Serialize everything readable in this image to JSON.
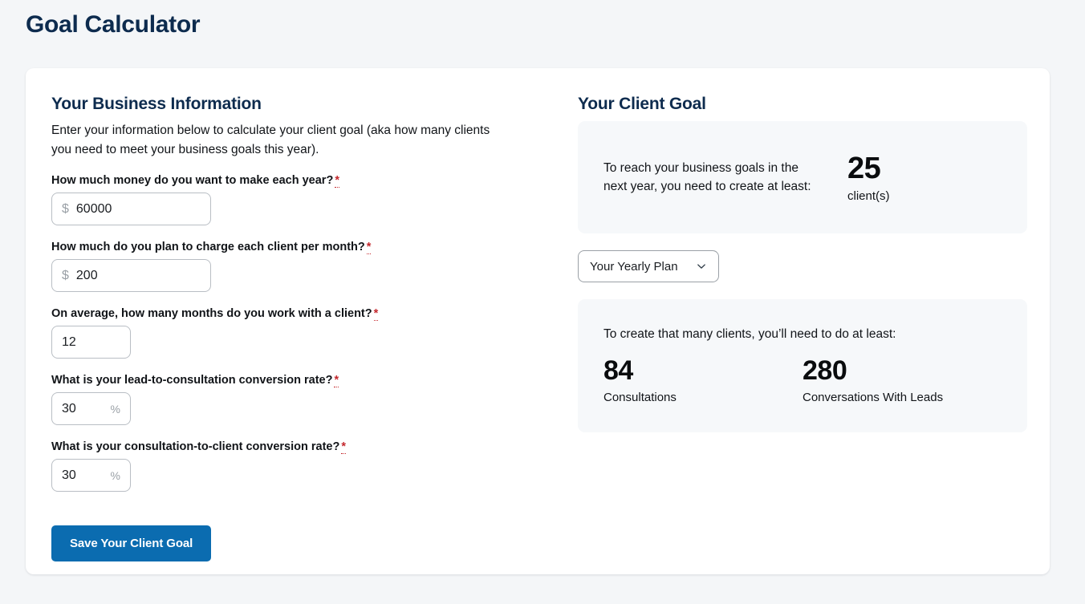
{
  "page": {
    "title": "Goal Calculator"
  },
  "business_info": {
    "heading": "Your Business Information",
    "intro": "Enter your information below to calculate your client goal (aka how many clients you need to meet your business goals this year).",
    "required_marker": "*",
    "fields": [
      {
        "label": "How much money do you want to make each year?",
        "prefix": "$",
        "suffix": "",
        "value": "60000",
        "placeholder": "",
        "name": "annual-income-goal"
      },
      {
        "label": "How much do you plan to charge each client per month?",
        "prefix": "$",
        "suffix": "",
        "value": "200",
        "placeholder": "",
        "name": "monthly-client-rate"
      },
      {
        "label": "On average, how many months do you work with a client?",
        "prefix": "",
        "suffix": "",
        "value": "12",
        "placeholder": "",
        "name": "months-per-client"
      },
      {
        "label": "What is your lead-to-consultation conversion rate?",
        "prefix": "",
        "suffix": "%",
        "value": "30",
        "placeholder": "",
        "name": "lead-to-consultation-rate"
      },
      {
        "label": "What is your consultation-to-client conversion rate?",
        "prefix": "",
        "suffix": "%",
        "value": "30",
        "placeholder": "",
        "name": "consultation-to-client-rate"
      }
    ],
    "save_label": "Save Your Client Goal"
  },
  "client_goal": {
    "heading": "Your Client Goal",
    "goal_sentence": "To reach your business goals in the next year, you need to create at least:",
    "goal_number": "25",
    "goal_unit": "client(s)",
    "plan_select": {
      "selected": "Your Yearly Plan",
      "options": [
        "Your Yearly Plan"
      ]
    },
    "actions_intro": "To create that many clients, you’ll need to do at least:",
    "metrics": [
      {
        "value": "84",
        "label": "Consultations"
      },
      {
        "value": "280",
        "label": "Conversations With Leads"
      }
    ]
  },
  "colors": {
    "page_background": "#f4f6f8",
    "card_background": "#ffffff",
    "heading_navy": "#0d2b4e",
    "accent_blue": "#0b6cb0",
    "required_red": "#c4282d",
    "panel_background": "#f6f8fa"
  }
}
